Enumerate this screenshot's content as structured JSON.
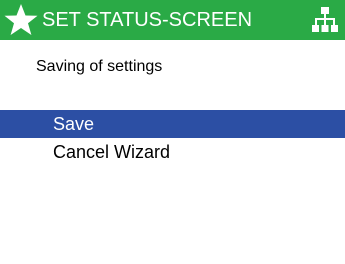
{
  "header": {
    "title": "SET STATUS-SCREEN",
    "left_icon": "star-icon",
    "right_icon": "network-tree-icon"
  },
  "subtitle": "Saving of settings",
  "menu": {
    "items": [
      {
        "label": "Save",
        "selected": true
      },
      {
        "label": "Cancel Wizard",
        "selected": false
      }
    ]
  },
  "colors": {
    "header_bg": "#2aaa46",
    "selection_bg": "#2c4fa4",
    "text": "#000000",
    "background": "#ffffff"
  }
}
